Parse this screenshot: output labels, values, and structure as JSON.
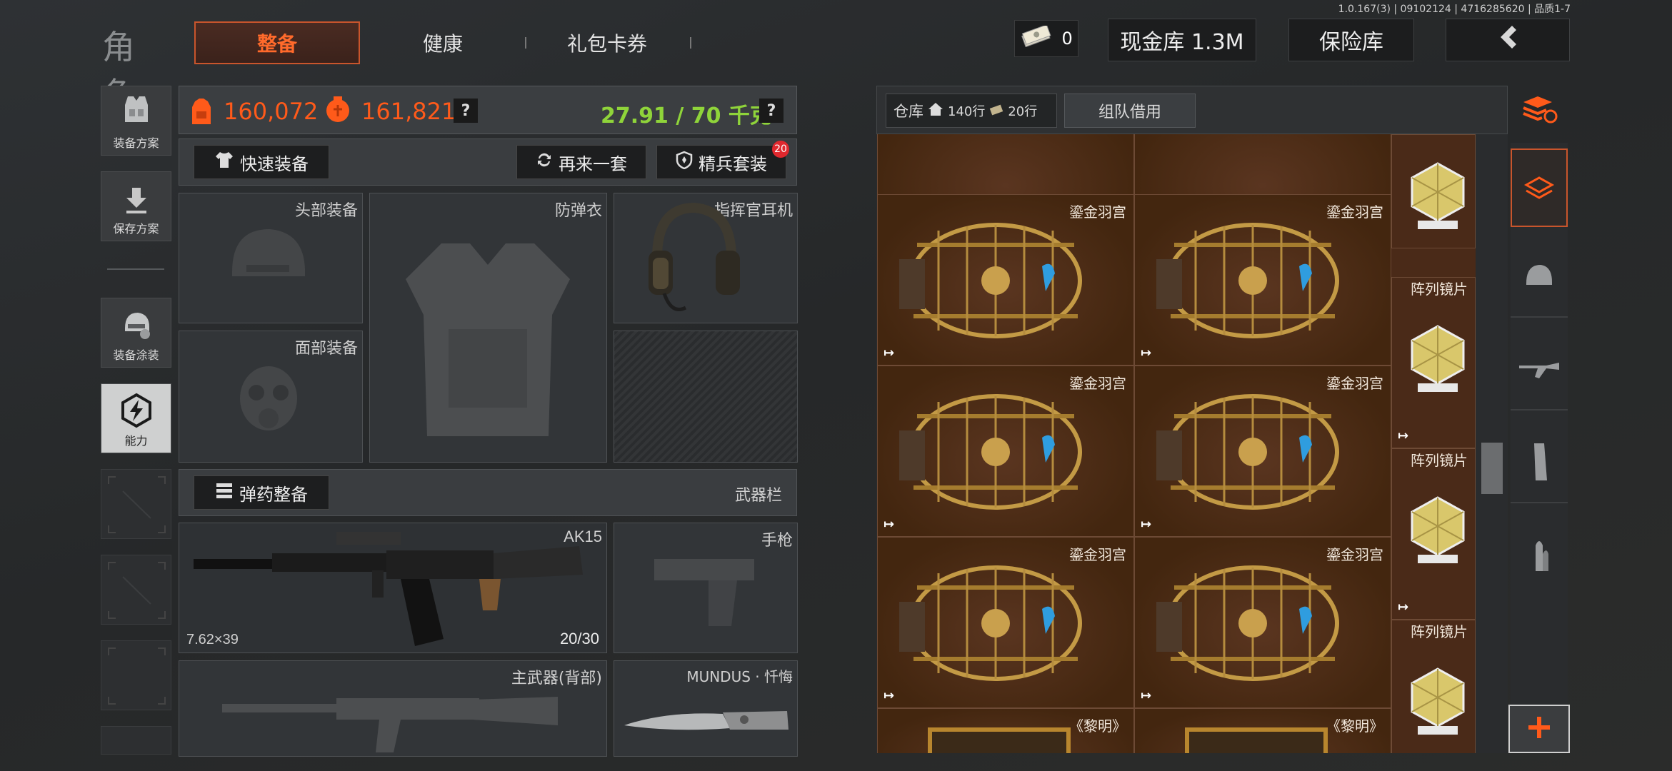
{
  "version": "1.0.167(3) | 09102124 | 4716285620 | 品质1-7",
  "header": {
    "title": "角色",
    "tabs": [
      "整备",
      "健康",
      "礼包卡券"
    ],
    "cash_count": "0",
    "cash_vault": "现金库 1.3M",
    "safe_box": "保险库"
  },
  "sidebar": {
    "items": [
      {
        "label": "装备方案"
      },
      {
        "label": "保存方案"
      },
      {
        "label": "装备涂装"
      },
      {
        "label": "能力"
      }
    ]
  },
  "stats": {
    "value_1": "160,072",
    "value_2": "161,821",
    "weight": "27.91 / 70 千克",
    "help": "?"
  },
  "actions": {
    "quick_equip": "快速装备",
    "again": "再来一套",
    "elite_set": "精兵套装",
    "elite_badge": "20"
  },
  "slots": {
    "head": "头部装备",
    "armor": "防弹衣",
    "headset": "指挥官耳机",
    "face": "面部装备",
    "ammo_button": "弹药整备",
    "weapon_bar": "武器栏",
    "primary_name": "AK15",
    "primary_caliber": "7.62×39",
    "primary_ammo": "20/30",
    "pistol": "手枪",
    "back_weapon": "主武器(背部)",
    "melee": "MUNDUS · 忏悔"
  },
  "warehouse": {
    "label": "仓库",
    "rows": "140行",
    "rows2": "20行",
    "team_borrow": "组队借用",
    "cage_name": "鎏金羽宫",
    "lens_name": "阵列镜片",
    "painting_name": "《黎明》",
    "link_icon": "↦"
  },
  "colors": {
    "accent": "#ff5a1a",
    "weight_green": "#8fd43a",
    "badge_red": "#e0282e"
  }
}
